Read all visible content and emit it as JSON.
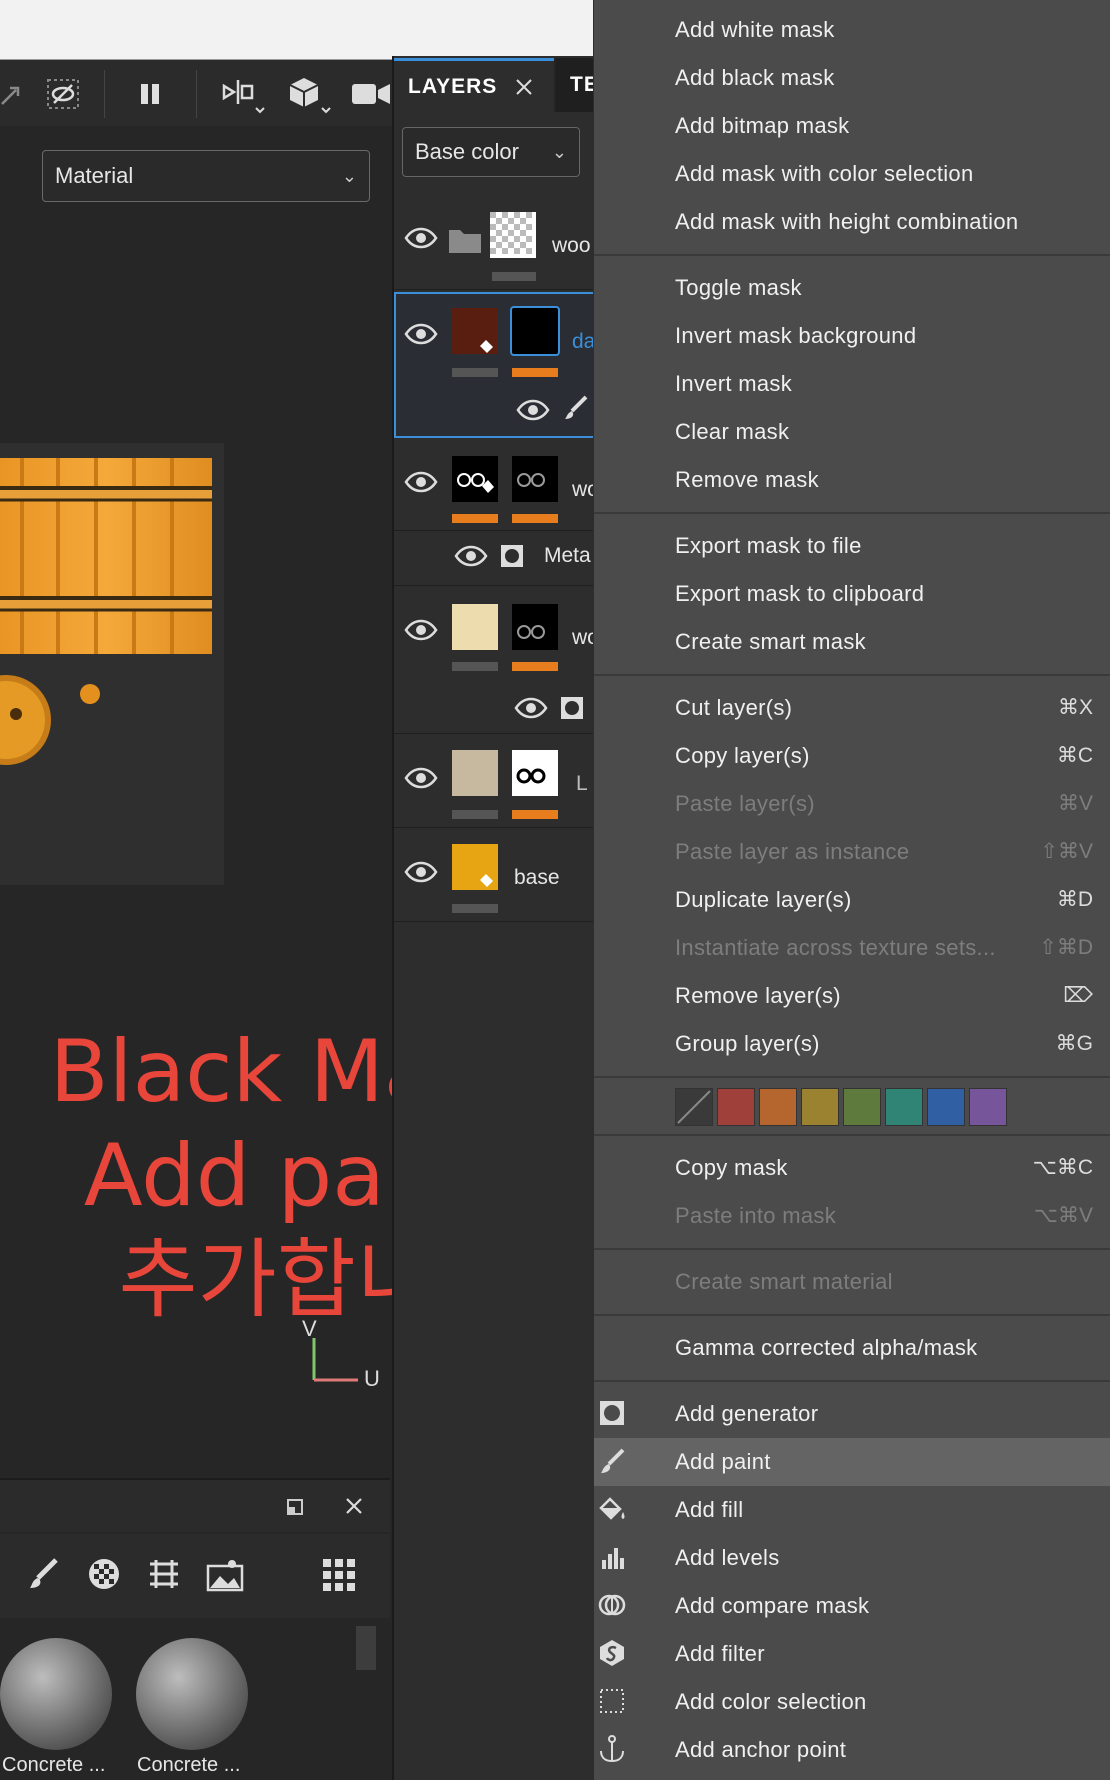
{
  "layers_panel": {
    "tabs": [
      {
        "label": "LAYERS"
      },
      {
        "label": "TE"
      }
    ],
    "channel": "Base color",
    "layers": [
      {
        "name": "woo"
      },
      {
        "name": "da"
      },
      {
        "name": "wo"
      },
      {
        "name": "Meta"
      },
      {
        "name": "wo"
      },
      {
        "name": "L"
      },
      {
        "name": "base"
      }
    ]
  },
  "viewport": {
    "display_mode": "Material",
    "axis_v": "V",
    "axis_u": "U",
    "annotation": [
      "Black Mask와",
      "Add paint를",
      "추가합니다."
    ]
  },
  "shelf": {
    "items": [
      {
        "label": "Concrete ..."
      },
      {
        "label": "Concrete ..."
      }
    ]
  },
  "menu": {
    "mask_items": [
      {
        "label": "Add white mask"
      },
      {
        "label": "Add black mask"
      },
      {
        "label": "Add bitmap mask"
      },
      {
        "label": "Add mask with color selection"
      },
      {
        "label": "Add mask with height combination"
      }
    ],
    "mask_ops": [
      {
        "label": "Toggle mask"
      },
      {
        "label": "Invert mask background"
      },
      {
        "label": "Invert mask"
      },
      {
        "label": "Clear mask"
      },
      {
        "label": "Remove mask"
      }
    ],
    "export_items": [
      {
        "label": "Export mask to file"
      },
      {
        "label": "Export mask to clipboard"
      },
      {
        "label": "Create smart mask"
      }
    ],
    "layer_items": [
      {
        "label": "Cut layer(s)",
        "shortcut": "⌘X",
        "enabled": true
      },
      {
        "label": "Copy layer(s)",
        "shortcut": "⌘C",
        "enabled": true
      },
      {
        "label": "Paste layer(s)",
        "shortcut": "⌘V",
        "enabled": false
      },
      {
        "label": "Paste layer as instance",
        "shortcut": "⇧⌘V",
        "enabled": false
      },
      {
        "label": "Duplicate layer(s)",
        "shortcut": "⌘D",
        "enabled": true
      },
      {
        "label": "Instantiate across texture sets...",
        "shortcut": "⇧⌘D",
        "enabled": false
      },
      {
        "label": "Remove layer(s)",
        "shortcut": "⌦",
        "enabled": true
      },
      {
        "label": "Group layer(s)",
        "shortcut": "⌘G",
        "enabled": true
      }
    ],
    "color_tags": [
      "none",
      "#a0403a",
      "#b5652e",
      "#9b8231",
      "#5e7a3c",
      "#2f8476",
      "#305fa3",
      "#77559a"
    ],
    "mask_clip_items": [
      {
        "label": "Copy mask",
        "shortcut": "⌥⌘C",
        "enabled": true
      },
      {
        "label": "Paste into mask",
        "shortcut": "⌥⌘V",
        "enabled": false
      }
    ],
    "smart_material": {
      "label": "Create smart material",
      "enabled": false
    },
    "gamma_item": {
      "label": "Gamma corrected alpha/mask"
    },
    "effect_items": [
      {
        "label": "Add generator",
        "icon": "generator-icon"
      },
      {
        "label": "Add paint",
        "icon": "brush-icon",
        "highlighted": true
      },
      {
        "label": "Add fill",
        "icon": "fill-bucket-icon"
      },
      {
        "label": "Add levels",
        "icon": "levels-icon"
      },
      {
        "label": "Add compare mask",
        "icon": "compare-mask-icon"
      },
      {
        "label": "Add filter",
        "icon": "filter-icon"
      },
      {
        "label": "Add color selection",
        "icon": "color-selection-icon"
      },
      {
        "label": "Add anchor point",
        "icon": "anchor-icon"
      }
    ]
  },
  "colors": {
    "menu_bg": "#4b4b4b",
    "highlight": "#646464",
    "accent_blue": "#3b8fd9",
    "mask_orange": "#e87d1e",
    "annotation_red": "#e8463a"
  }
}
